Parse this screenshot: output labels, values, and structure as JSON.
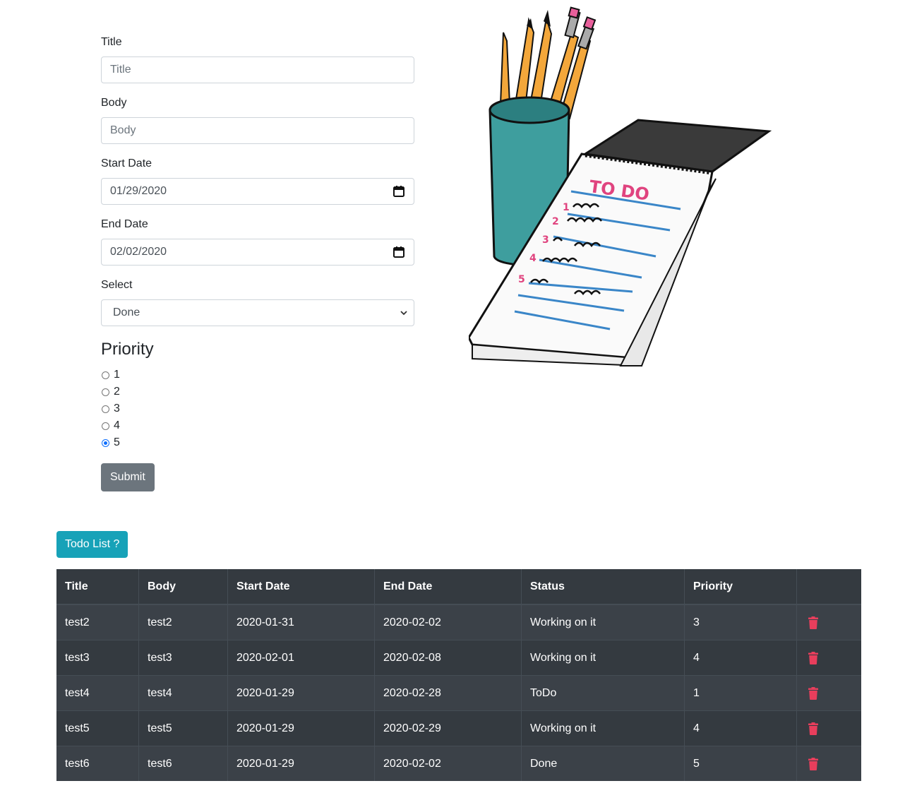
{
  "form": {
    "title_label": "Title",
    "title_placeholder": "Title",
    "body_label": "Body",
    "body_placeholder": "Body",
    "start_label": "Start Date",
    "start_value": "01/29/2020",
    "end_label": "End Date",
    "end_value": "02/02/2020",
    "select_label": "Select",
    "select_value": "Done",
    "priority_title": "Priority",
    "priority_options": [
      "1",
      "2",
      "3",
      "4",
      "5"
    ],
    "priority_selected": "5",
    "submit_label": "Submit"
  },
  "illustration": {
    "notepad_heading": "TO DO",
    "list_numbers": [
      "1",
      "2",
      "3",
      "4",
      "5"
    ]
  },
  "todo_button": "Todo List ?",
  "table": {
    "headers": [
      "Title",
      "Body",
      "Start Date",
      "End Date",
      "Status",
      "Priority",
      ""
    ],
    "rows": [
      [
        "test2",
        "test2",
        "2020-01-31",
        "2020-02-02",
        "Working on it",
        "3"
      ],
      [
        "test3",
        "test3",
        "2020-02-01",
        "2020-02-08",
        "Working on it",
        "4"
      ],
      [
        "test4",
        "test4",
        "2020-01-29",
        "2020-02-28",
        "ToDo",
        "1"
      ],
      [
        "test5",
        "test5",
        "2020-01-29",
        "2020-02-29",
        "Working on it",
        "4"
      ],
      [
        "test6",
        "test6",
        "2020-01-29",
        "2020-02-02",
        "Done",
        "5"
      ]
    ]
  },
  "icons": {
    "date": "calendar-icon",
    "select": "chevron-down-icon",
    "delete": "trash-icon"
  },
  "colors": {
    "delete": "#e83e5c",
    "todo_button": "#17a2b8",
    "submit_button": "#6c757d",
    "table_bg": "#343a40"
  }
}
